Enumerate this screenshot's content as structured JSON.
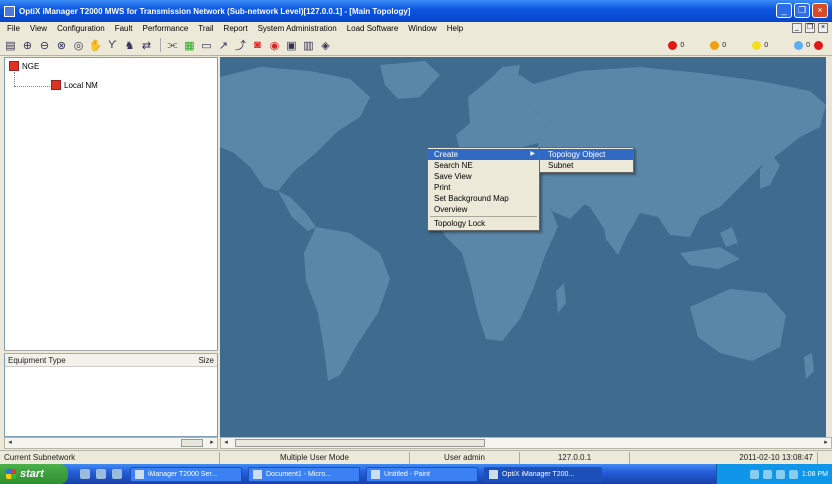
{
  "window": {
    "title": "OptiX iManager T2000 MWS for Transmission Network (Sub-network Level)[127.0.0.1] - [Main Topology]"
  },
  "menubar": {
    "items": [
      "File",
      "View",
      "Configuration",
      "Fault",
      "Performance",
      "Trail",
      "Report",
      "System Administration",
      "Load Software",
      "Window",
      "Help"
    ]
  },
  "alarms": [
    {
      "color": "#e01818",
      "count": "0"
    },
    {
      "color": "#f0a010",
      "count": "0"
    },
    {
      "color": "#f0e020",
      "count": "0"
    },
    {
      "color": "#5ab0f0",
      "count": "0"
    }
  ],
  "tree": {
    "root": "NGE",
    "child": "Local NM"
  },
  "table": {
    "col1": "Equipment Type",
    "col2": "Size"
  },
  "context_menu": {
    "items": [
      "Create",
      "Search NE",
      "Save View",
      "Print",
      "Set Background Map",
      "Overview",
      "Topology Lock"
    ],
    "submenu": [
      "Topology Object",
      "Subnet"
    ]
  },
  "status": {
    "text": "Current Subnetwork",
    "mode": "Multiple User Mode",
    "user": "User admin",
    "ip": "127.0.0.1",
    "time": "2011-02-10 13:08:47"
  },
  "taskbar": {
    "start": "start",
    "tasks": [
      "iManager T2000 Ser...",
      "Document1 - Micro...",
      "Untitled - Paint",
      "OptiX iManager T200..."
    ],
    "clock": "1:08 PM"
  }
}
